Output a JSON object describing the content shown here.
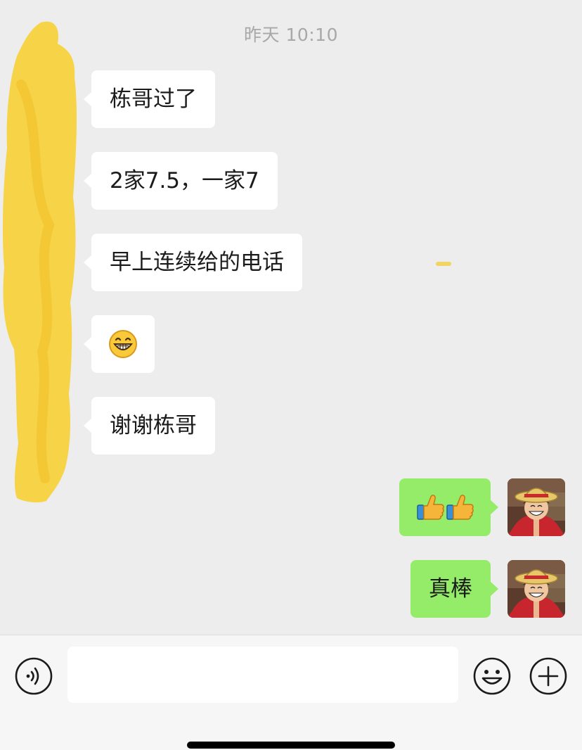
{
  "chat": {
    "timestamp": "昨天 10:10",
    "incoming_messages": [
      {
        "text": "栋哥过了"
      },
      {
        "text": "2家7.5，一家7"
      },
      {
        "text": "早上连续给的电话"
      },
      {
        "text": "",
        "emoji": "grinning-face-emoji"
      },
      {
        "text": "谢谢栋哥"
      }
    ],
    "outgoing_messages": [
      {
        "text": "",
        "emoji": "thumbs-up-emoji x2"
      },
      {
        "text": "真棒"
      }
    ]
  },
  "input_bar": {
    "message_value": "",
    "icons": [
      "voice-icon",
      "emoji-icon",
      "add-icon"
    ]
  },
  "colors": {
    "chat_background": "#ededed",
    "incoming_bubble": "#ffffff",
    "outgoing_bubble": "#95ec69",
    "redaction": "#f7d23e"
  }
}
